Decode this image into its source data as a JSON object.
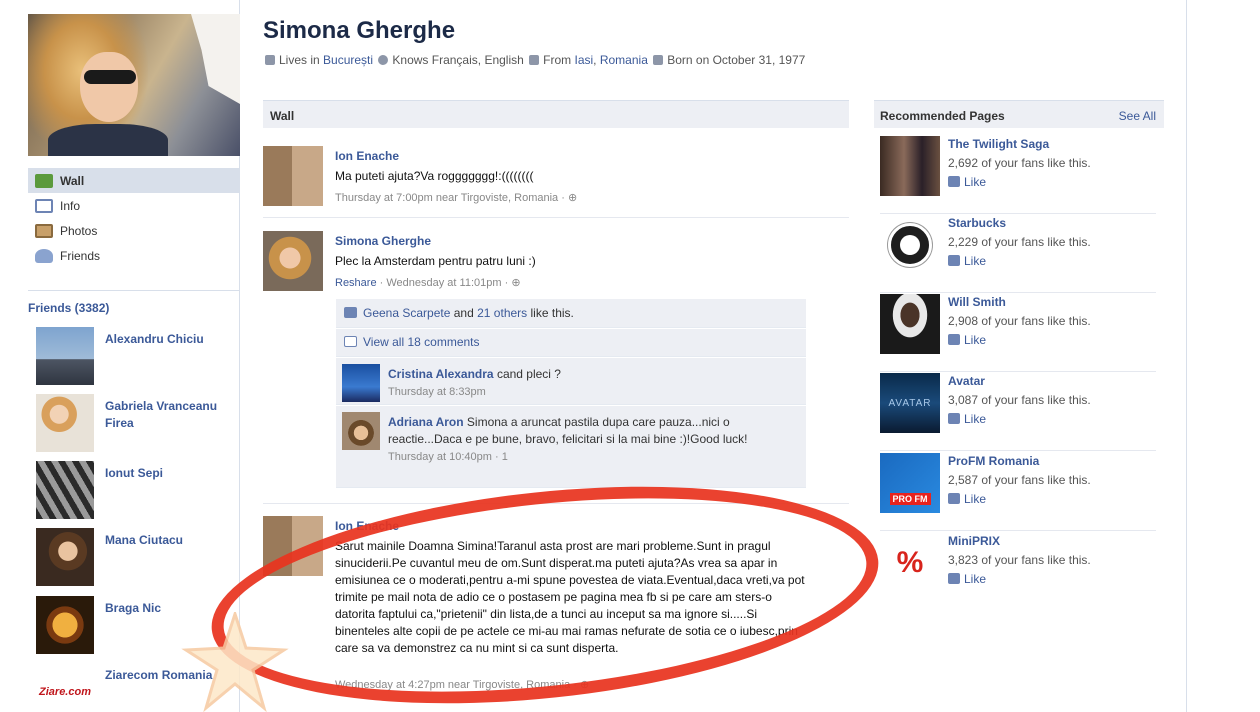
{
  "profile": {
    "name": "Simona Gherghe",
    "lives_in_label": "Lives in",
    "lives_in": "București",
    "knows": "Knows Français, English",
    "from_label": "From",
    "from_city": "Iasi",
    "from_country": "Romania",
    "born": "Born on October 31, 1977"
  },
  "nav": [
    {
      "label": "Wall",
      "icon": "wall-icon"
    },
    {
      "label": "Info",
      "icon": "info-icon"
    },
    {
      "label": "Photos",
      "icon": "photos-icon"
    },
    {
      "label": "Friends",
      "icon": "friends-icon"
    }
  ],
  "friends": {
    "header": "Friends (3382)",
    "items": [
      {
        "name": "Alexandru Chiciu"
      },
      {
        "name": "Gabriela Vranceanu Firea"
      },
      {
        "name": "Ionut Sepi"
      },
      {
        "name": "Mana Ciutacu"
      },
      {
        "name": "Braga Nic"
      },
      {
        "name": "Ziarecom Romania"
      }
    ]
  },
  "wall": {
    "header": "Wall",
    "posts": [
      {
        "author": "Ion Enache",
        "text": "Ma puteti ajuta?Va roggggggg!:((((((((",
        "meta": "Thursday at 7:00pm near Tirgoviste, Romania ·"
      },
      {
        "author": "Simona Gherghe",
        "text": "Plec la Amsterdam pentru patru luni :)",
        "reshare": "Reshare",
        "meta": " · Wednesday at 11:01pm ·",
        "likes_name": "Geena Scarpete",
        "likes_and": "and",
        "likes_others": "21 others",
        "likes_suffix": "like this.",
        "view_all": "View all 18 comments",
        "comments": [
          {
            "author": "Cristina Alexandra",
            "text": "cand pleci ?",
            "time": "Thursday at 8:33pm"
          },
          {
            "author": "Adriana Aron",
            "text": "Simona a aruncat pastila dupa care pauza...nici o reactie...Daca e pe bune, bravo, felicitari si la mai bine :)!Good luck!",
            "time": "Thursday at 10:40pm · 1"
          }
        ]
      },
      {
        "author": "Ion Enache",
        "text": "Sarut mainile Doamna Simina!Taranul asta prost are mari probleme.Sunt in pragul sinuciderii.Pe cuvantul meu de om.Sunt disperat.ma puteti ajuta?As vrea sa apar in emisiunea ce o moderati,pentru a-mi spune povestea de viata.Eventual,daca vreti,va pot trimite pe mail nota de adio ce o postasem pe pagina mea fb si pe care am sters-o datorita faptului ca,\"prietenii\" din lista,de a tunci au inceput sa ma ignore si.....Si binenteles alte copii de pe actele ce mi-au mai ramas nefurate de sotia ce o iubesc,prin care sa va demonstrez ca nu mint si ca sunt disperta.",
        "meta": "Wednesday at 4:27pm near Tirgoviste, Romania ·"
      }
    ]
  },
  "recommended": {
    "header": "Recommended Pages",
    "see_all": "See All",
    "like_label": "Like",
    "pages": [
      {
        "name": "The Twilight Saga",
        "fans": "2,692 of your fans like this."
      },
      {
        "name": "Starbucks",
        "fans": "2,229 of your fans like this."
      },
      {
        "name": "Will Smith",
        "fans": "2,908 of your fans like this."
      },
      {
        "name": "Avatar",
        "fans": "3,087 of your fans like this."
      },
      {
        "name": "ProFM Romania",
        "fans": "2,587 of your fans like this."
      },
      {
        "name": "MiniPRIX",
        "fans": "3,823 of your fans like this."
      }
    ]
  },
  "thumb_text": {
    "avatar_label": "AVATAR",
    "profm_label": "PRO FM",
    "miniprix_label": "%",
    "ziare_label": "Ziare.com"
  },
  "colors": {
    "link": "#3b5998",
    "header_bg": "#edeff4",
    "annotation_red": "#e8341f"
  }
}
